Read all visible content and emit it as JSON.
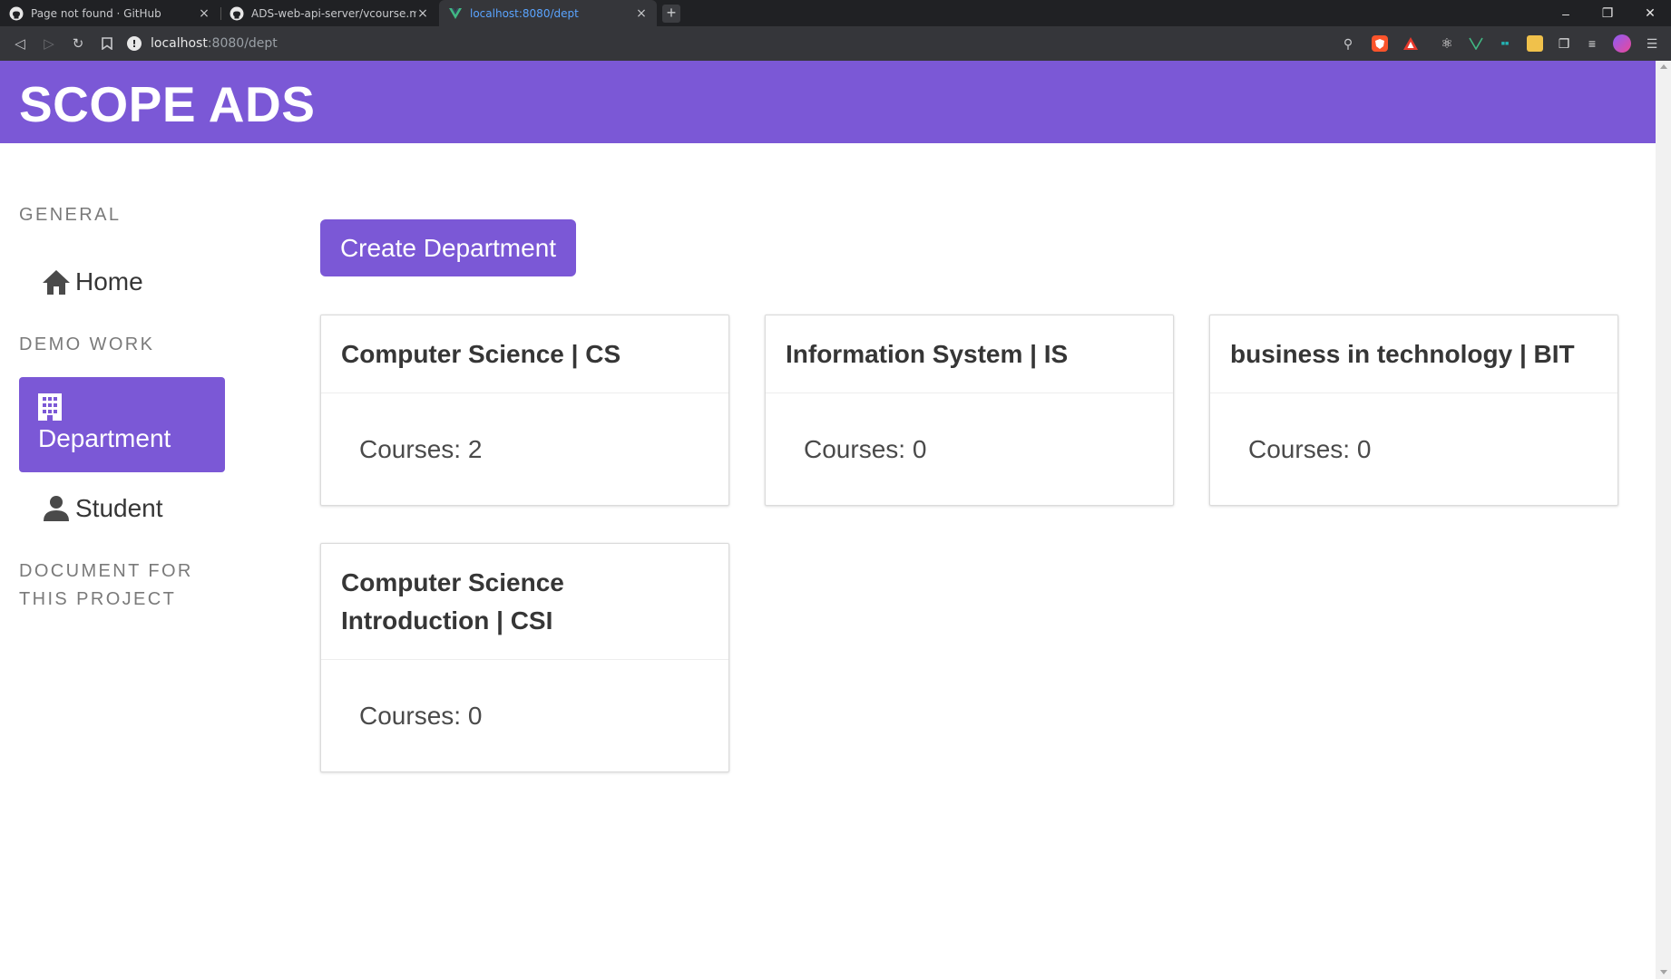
{
  "browser": {
    "tabs": [
      {
        "title": "Page not found · GitHub",
        "icon": "github-icon",
        "active": false
      },
      {
        "title": "ADS-web-api-server/vcourse.md at",
        "icon": "github-icon",
        "active": false
      },
      {
        "title": "localhost:8080/dept",
        "icon": "vue-icon",
        "active": true
      }
    ],
    "url_host": "localhost",
    "url_path": ":8080/dept",
    "colors": {
      "tab_bar": "#202124",
      "toolbar": "#35363a",
      "active_tab_text": "#5aa4ff"
    }
  },
  "app": {
    "brand": "SCOPE ADS",
    "accent_color": "#7b58d6"
  },
  "sidebar": {
    "general_label": "GENERAL",
    "home_label": "Home",
    "demo_label": "DEMO WORK",
    "department_label": "Department",
    "student_label": "Student",
    "document_label_line1": "DOCUMENT FOR",
    "document_label_line2": "THIS PROJECT"
  },
  "main": {
    "create_button_label": "Create Department",
    "departments": [
      {
        "name": "Computer Science | CS",
        "courses": "Courses: 2"
      },
      {
        "name": "Information System | IS",
        "courses": "Courses: 0"
      },
      {
        "name": "business in technology | BIT",
        "courses": "Courses: 0"
      },
      {
        "name_line1": "Computer Science",
        "name_line2": "Introduction | CSI",
        "courses": "Courses: 0"
      }
    ]
  }
}
